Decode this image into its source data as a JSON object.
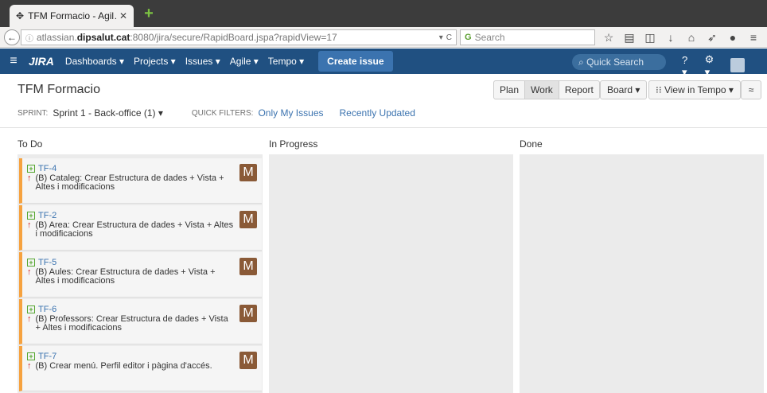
{
  "browser": {
    "tab_title": "TFM Formacio - Agil…",
    "url_prefix": "atlassian.",
    "url_host": "dipsalut.cat",
    "url_rest": ":8080/jira/secure/RapidBoard.jspa?rapidView=17",
    "search_placeholder": "Search",
    "toolbar_icons": [
      "star-icon",
      "reading-list-icon",
      "pocket-icon",
      "download-icon",
      "home-icon",
      "send-icon",
      "chat-icon",
      "menu-icon"
    ]
  },
  "jira": {
    "logo": "JIRA",
    "menus": [
      "Dashboards ▾",
      "Projects ▾",
      "Issues ▾",
      "Agile ▾",
      "Tempo ▾"
    ],
    "create": "Create issue",
    "quick_search": "Quick Search"
  },
  "board": {
    "title": "TFM Formacio",
    "modes": [
      "Plan",
      "Work",
      "Report"
    ],
    "board_button": "Board ▾",
    "tempo_button": "View in Tempo ▾",
    "sprint_label": "SPRINT:",
    "sprint_value": "Sprint 1 - Back-office (1) ▾",
    "quickfilters_label": "QUICK FILTERS:",
    "quickfilters": [
      "Only My Issues",
      "Recently Updated"
    ],
    "columns": [
      "To Do",
      "In Progress",
      "Done"
    ]
  },
  "cards": [
    {
      "key": "TF-4",
      "summary": "(B) Cataleg: Crear Estructura de dades + Vista + Altes i modificacions",
      "assignee": "M"
    },
    {
      "key": "TF-2",
      "summary": "(B) Area: Crear Estructura de dades + Vista + Altes i modificacions",
      "assignee": "M"
    },
    {
      "key": "TF-5",
      "summary": "(B) Aules: Crear Estructura de dades + Vista + Altes i modificacions",
      "assignee": "M"
    },
    {
      "key": "TF-6",
      "summary": "(B) Professors: Crear Estructura de dades + Vista + Altes i modificacions",
      "assignee": "M"
    },
    {
      "key": "TF-7",
      "summary": "(B) Crear menú. Perfil editor i pàgina d'accés.",
      "assignee": "M"
    }
  ],
  "colors": {
    "jira_header": "#205081",
    "card_border": "#f6a23f",
    "avatar": "#8a5a37",
    "link": "#3b73af"
  }
}
